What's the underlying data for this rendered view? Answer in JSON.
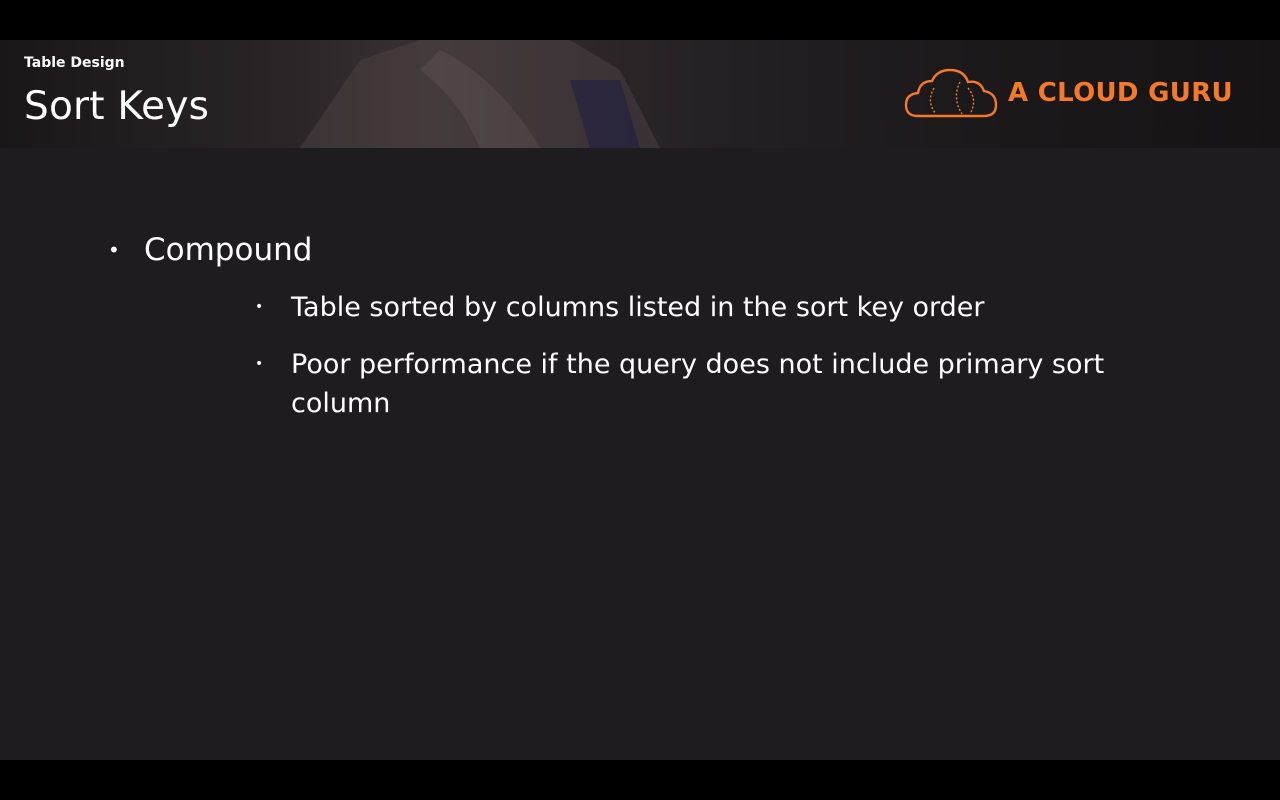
{
  "header": {
    "section_label": "Table Design",
    "title": "Sort Keys",
    "logo_text": "A CLOUD GURU",
    "logo_icon": "cloud-icon"
  },
  "colors": {
    "accent": "#f5792a",
    "background": "#1e1c1f",
    "text": "#ffffff"
  },
  "bullets": [
    {
      "label": "Compound",
      "children": [
        "Table sorted by columns listed in the sort key order",
        "Poor performance if the query does not include primary sort column"
      ]
    }
  ]
}
